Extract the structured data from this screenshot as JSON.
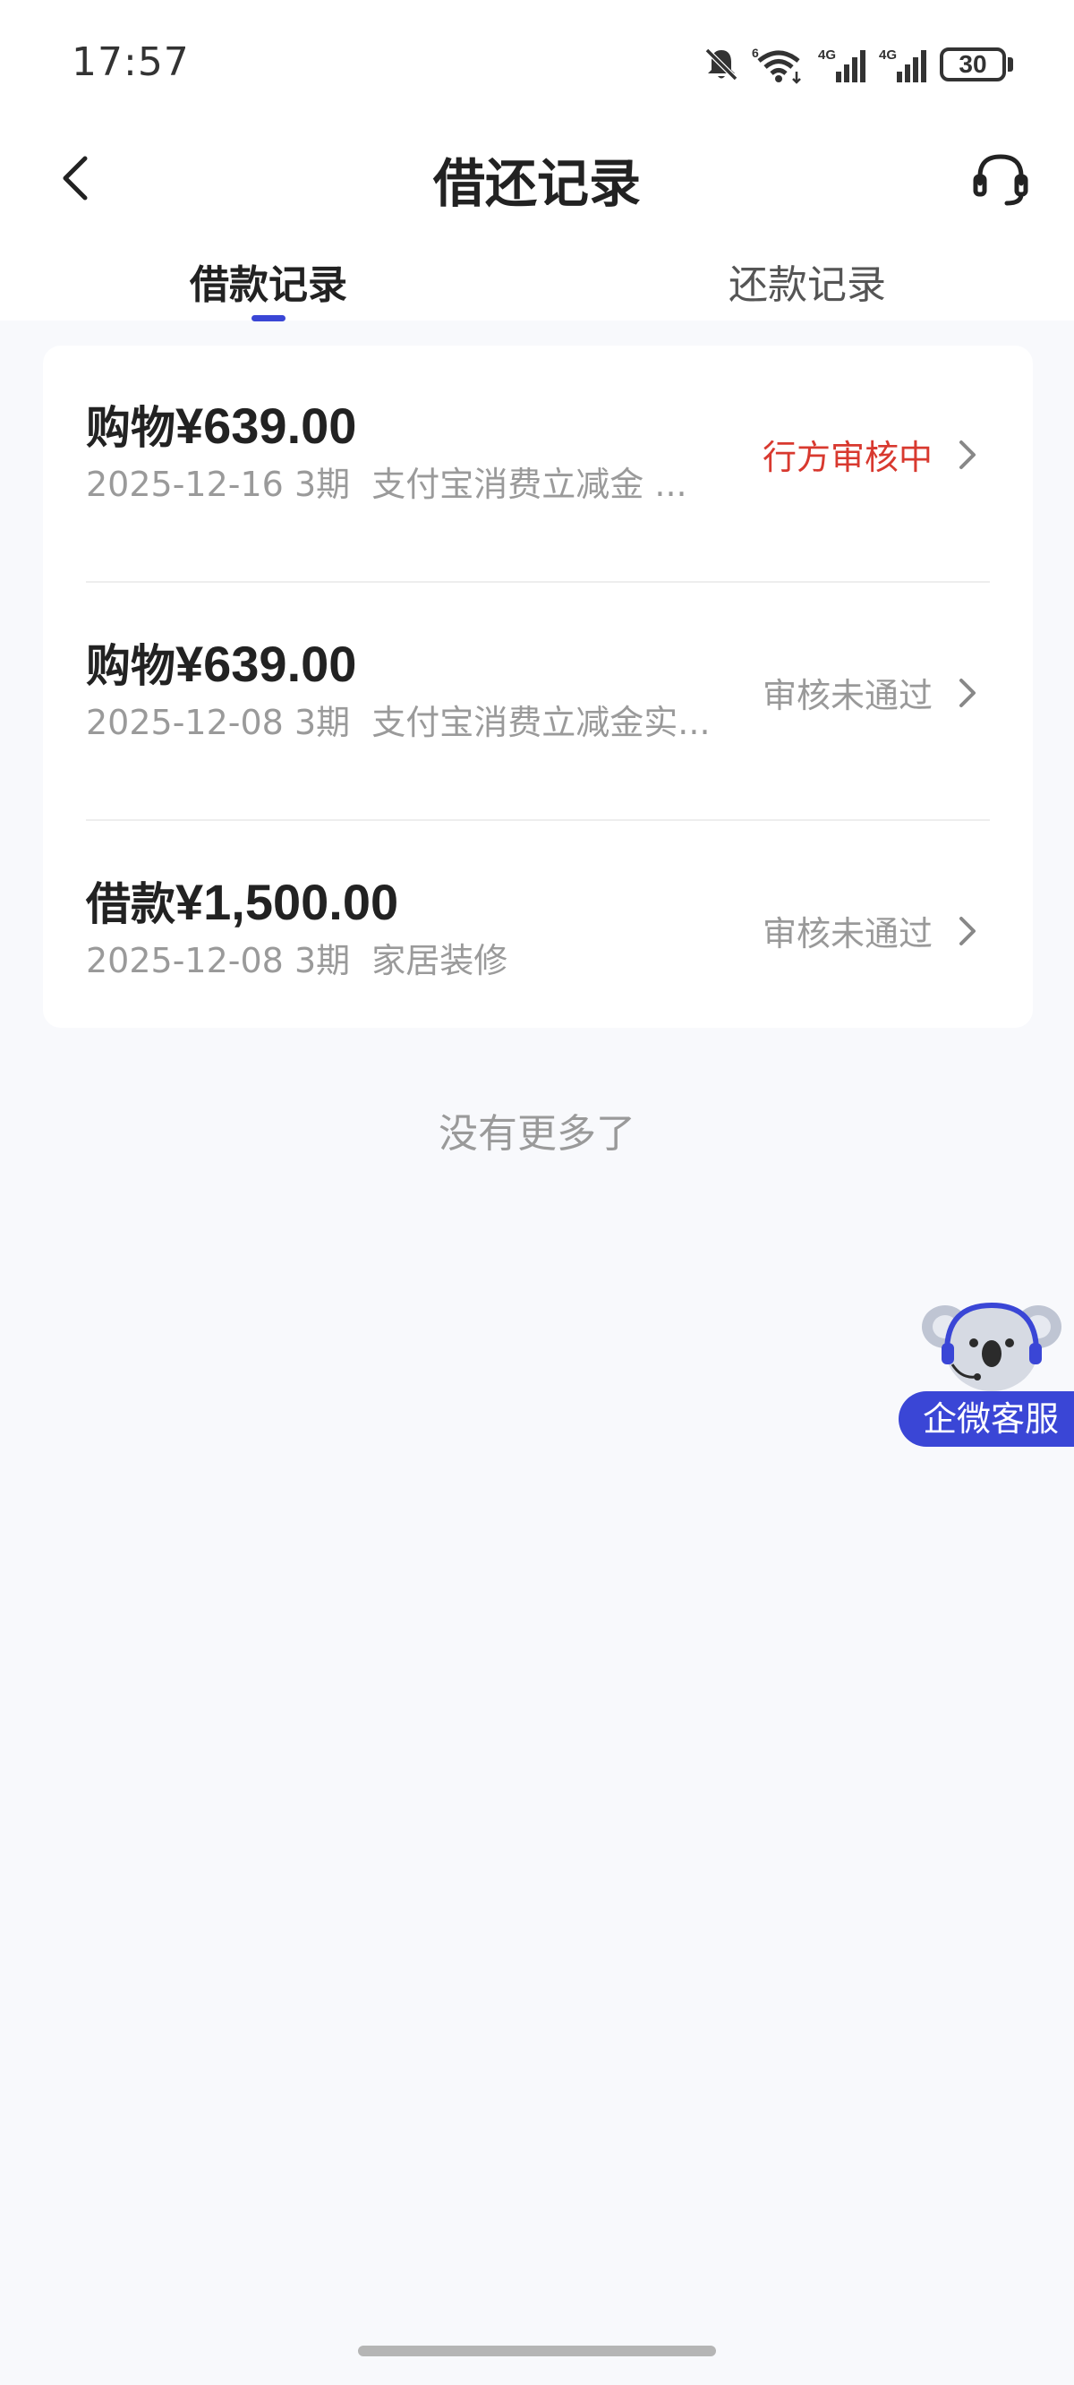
{
  "status_bar": {
    "time": "17:57",
    "battery": "30",
    "icons": [
      "bell-off-icon",
      "wifi-icon",
      "signal-4g-icon",
      "signal-4g-icon",
      "battery-icon"
    ]
  },
  "header": {
    "title": "借还记录",
    "back_icon": "chevron-left-icon",
    "service_icon": "headset-icon"
  },
  "tabs": [
    {
      "label": "借款记录",
      "active": true
    },
    {
      "label": "还款记录",
      "active": false
    }
  ],
  "records": [
    {
      "type": "购物",
      "amount": "¥639.00",
      "date": "2025-12-16",
      "periods": "3期",
      "purpose": "支付宝消费立减金 ...",
      "status": "行方审核中",
      "status_color": "#d8392f"
    },
    {
      "type": "购物",
      "amount": "¥639.00",
      "date": "2025-12-08",
      "periods": "3期",
      "purpose": "支付宝消费立减金实...",
      "status": "审核未通过",
      "status_color": "#999999"
    },
    {
      "type": "借款",
      "amount": "¥1,500.00",
      "date": "2025-12-08",
      "periods": "3期",
      "purpose": "家居装修",
      "status": "审核未通过",
      "status_color": "#999999"
    }
  ],
  "footer_text": "没有更多了",
  "float_service": {
    "label": "企微客服",
    "icon": "koala-headset-icon"
  },
  "colors": {
    "accent": "#3a46d6",
    "pending": "#d8392f",
    "muted": "#999999",
    "background": "#f8f9fc"
  }
}
